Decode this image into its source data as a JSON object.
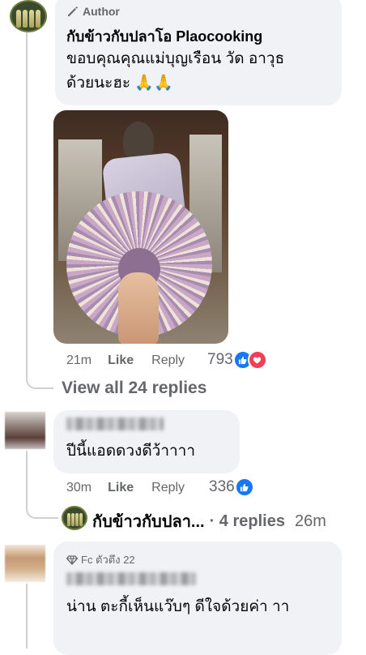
{
  "comment_main": {
    "badge": "Author",
    "author": "กับข้าวกับปลาโอ Plaocooking",
    "text": "ขอบคุณคุณแม่บุญเรือน วัด อาวุธ ด้วยนะฮะ 🙏🙏",
    "time": "21m",
    "like_label": "Like",
    "reply_label": "Reply",
    "reaction_count": "793",
    "reactions": [
      "like-icon",
      "love-icon"
    ],
    "view_replies": "View all 24 replies"
  },
  "comment_second": {
    "text": "ปีนี้แอดดวงดีว้าาาา",
    "time": "30m",
    "like_label": "Like",
    "reply_label": "Reply",
    "reaction_count": "336",
    "reactions": [
      "like-icon"
    ]
  },
  "reply_summary": {
    "name": "กับข้าวกับปลา...",
    "count": "· 4 replies",
    "time": "26m"
  },
  "comment_third": {
    "badge": "Fc ตัวตึง 22",
    "text": "น่าน ตะกี้เห็นแว๊บๆ ดีใจด้วยค่า าา"
  },
  "colors": {
    "bubble": "#f0f2f5",
    "meta_text": "#65676b",
    "like_blue": "#1877f2",
    "love_red": "#f33e58"
  }
}
